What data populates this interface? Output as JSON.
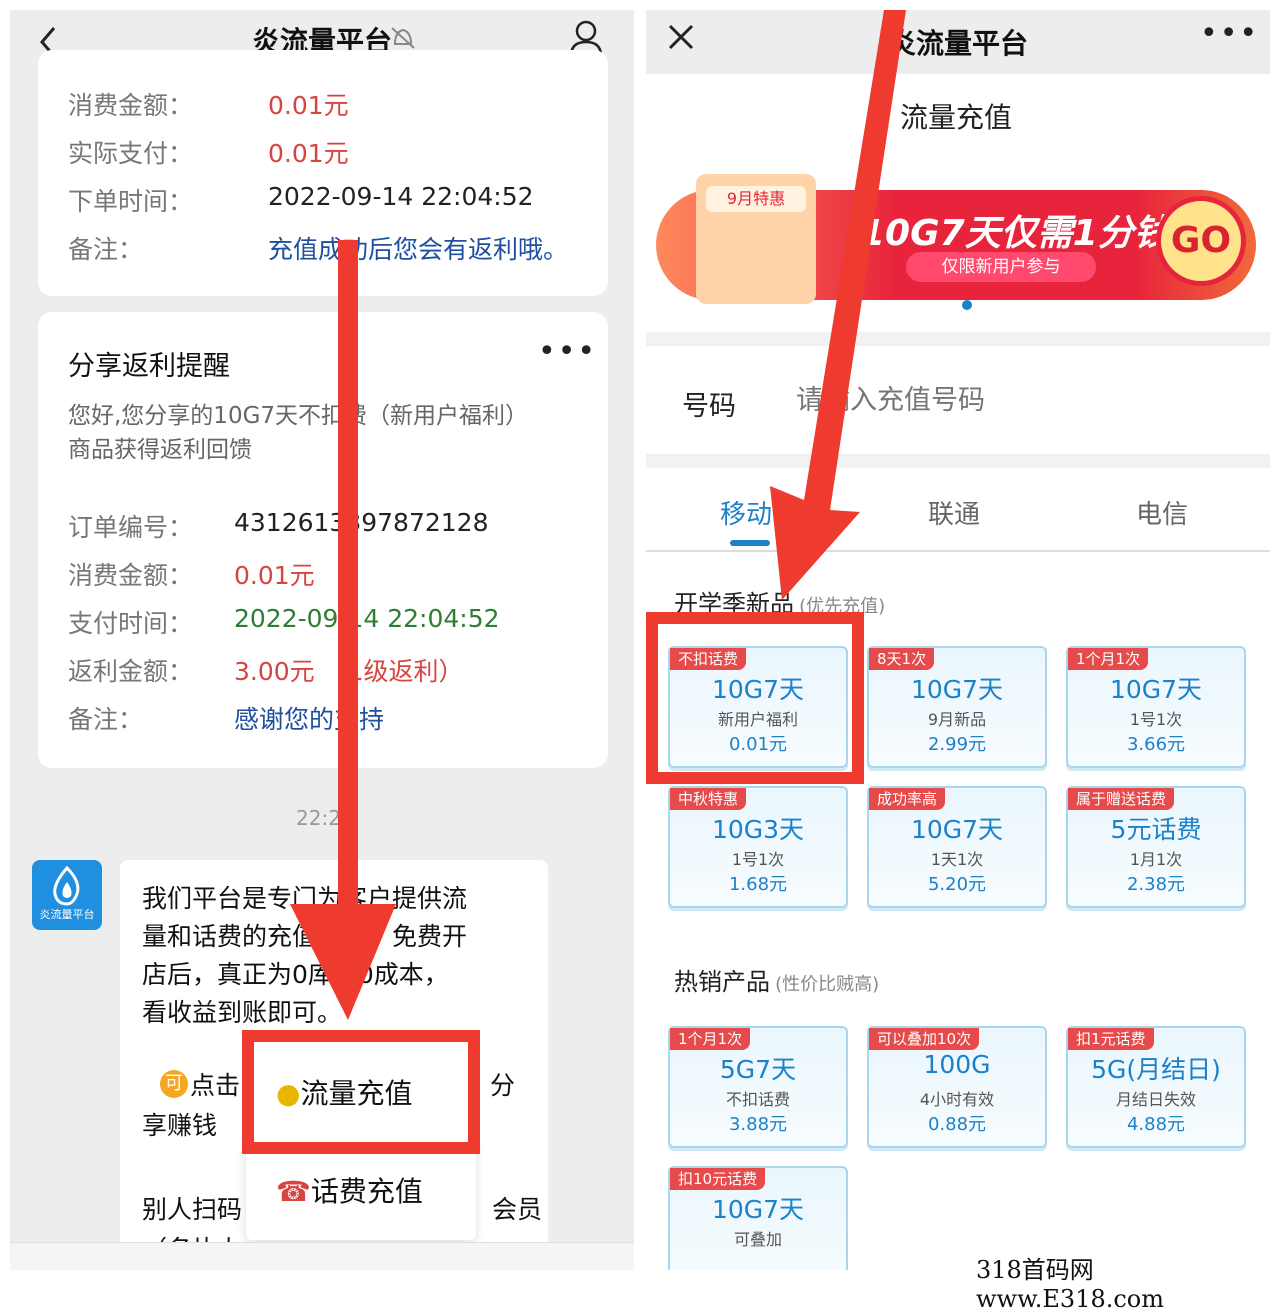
{
  "left": {
    "title": "炎流量平台",
    "order_top": [
      {
        "label": "消费金额：",
        "value": "0.01元",
        "color": "red"
      },
      {
        "label": "实际支付：",
        "value": "0.01元",
        "color": "red"
      },
      {
        "label": "下单时间：",
        "value": "2022-09-14  22:04:52",
        "color": "dark"
      },
      {
        "label": "备注：",
        "value": "充值成功后您会有返利哦。",
        "color": "blue"
      }
    ],
    "share": {
      "title": "分享返利提醒",
      "desc_line1": "您好,您分享的10G7天不扣费（新用户福利）",
      "desc_line2": "商品获得返利回馈",
      "rows": [
        {
          "label": "订单编号：",
          "value": "4312613397872128",
          "color": "dark"
        },
        {
          "label": "消费金额：",
          "value": "0.01元",
          "color": "red"
        },
        {
          "label": "支付时间：",
          "value": "2022-09-14  22:04:52",
          "color": "green"
        },
        {
          "label": "返利金额：",
          "value": "3.00元 （1级返利）",
          "color": "red"
        },
        {
          "label": "备注：",
          "value": "感谢您的支持",
          "color": "blue"
        }
      ]
    },
    "time_label": "22:2",
    "avatar_text": "炎流量平台",
    "message": {
      "line1": "我们平台是专门为客户提供流",
      "line2": "量和话费的充值平台，免费开",
      "line3": "店后，真正为0库存0成本，",
      "line4": "看收益到账即可。",
      "line5a": "点击",
      "line5b": "分",
      "line6": "享赚钱",
      "line7a": "别人扫码",
      "line7b": "会员",
      "line8": "（名片上"
    },
    "menu": {
      "flow": "流量充值",
      "phone": "话费充值"
    }
  },
  "right": {
    "title": "炎流量平台",
    "page_title": "流量充值",
    "banner": {
      "badge": "9月特惠",
      "headline": "10G7天仅需1分钱",
      "sub": "仅限新用户参与",
      "go": "GO"
    },
    "phone_label": "号码",
    "phone_placeholder": "请输入充值号码",
    "tabs": [
      "移动",
      "联通",
      "电信"
    ],
    "section1": {
      "title": "开学季新品",
      "note": "(优先充值)"
    },
    "section2": {
      "title": "热销产品",
      "note": "(性价比贼高)"
    },
    "products1": [
      {
        "tag": "不扣话费",
        "name": "10G7天",
        "desc": "新用户福利",
        "price": "0.01元"
      },
      {
        "tag": "8天1次",
        "name": "10G7天",
        "desc": "9月新品",
        "price": "2.99元"
      },
      {
        "tag": "1个月1次",
        "name": "10G7天",
        "desc": "1号1次",
        "price": "3.66元"
      },
      {
        "tag": "中秋特惠",
        "name": "10G3天",
        "desc": "1号1次",
        "price": "1.68元"
      },
      {
        "tag": "成功率高",
        "name": "10G7天",
        "desc": "1天1次",
        "price": "5.20元"
      },
      {
        "tag": "属于赠送话费",
        "name": "5元话费",
        "desc": "1月1次",
        "price": "2.38元"
      }
    ],
    "products2": [
      {
        "tag": "1个月1次",
        "name": "5G7天",
        "desc": "不扣话费",
        "price": "3.88元"
      },
      {
        "tag": "可以叠加10次",
        "name": "100G",
        "desc": "4小时有效",
        "price": "0.88元"
      },
      {
        "tag": "扣1元话费",
        "name": "5G(月结日)",
        "desc": "月结日失效",
        "price": "4.88元"
      },
      {
        "tag": "扣10元话费",
        "name": "10G7天",
        "desc": "可叠加",
        "price": ""
      }
    ]
  },
  "watermark": "318首码网  www.E318.com",
  "colors": {
    "arrow": "#ee3a2f",
    "accent_blue": "#1b82c8",
    "price_red": "#d6453f"
  }
}
